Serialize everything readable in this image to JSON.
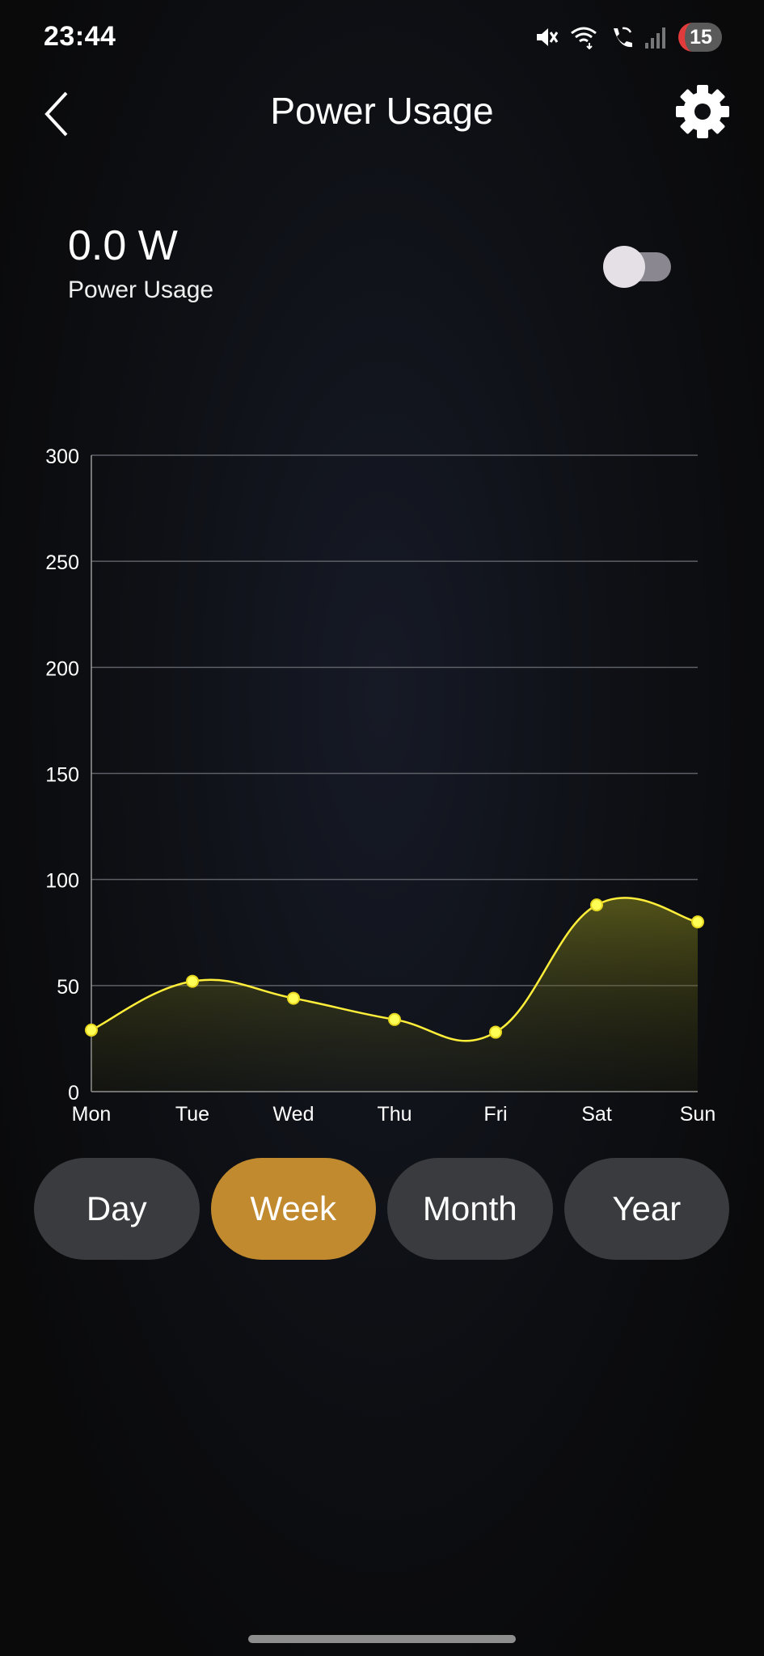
{
  "status_bar": {
    "time": "23:44",
    "badge_count": "15",
    "icons": [
      "mute-icon",
      "wifi-icon",
      "wifi-call-icon",
      "signal-icon"
    ]
  },
  "header": {
    "title": "Power Usage",
    "back_icon": "chevron-left-icon",
    "settings_icon": "gear-icon"
  },
  "power": {
    "value": "0.0 W",
    "label": "Power Usage",
    "toggle_on": false
  },
  "chart_data": {
    "type": "line",
    "categories": [
      "Mon",
      "Tue",
      "Wed",
      "Thu",
      "Fri",
      "Sat",
      "Sun"
    ],
    "values": [
      29,
      52,
      44,
      34,
      28,
      88,
      80
    ],
    "ylim": [
      0,
      300
    ],
    "yticks": [
      0,
      50,
      100,
      150,
      200,
      250,
      300
    ],
    "grid": true,
    "line_color": "#ffee3a",
    "fill": "area-gradient"
  },
  "periods": {
    "items": [
      "Day",
      "Week",
      "Month",
      "Year"
    ],
    "active": "Week"
  },
  "colors": {
    "accent": "#c28a2e",
    "button_bg": "#3a3b3f",
    "line": "#ffee3a"
  }
}
